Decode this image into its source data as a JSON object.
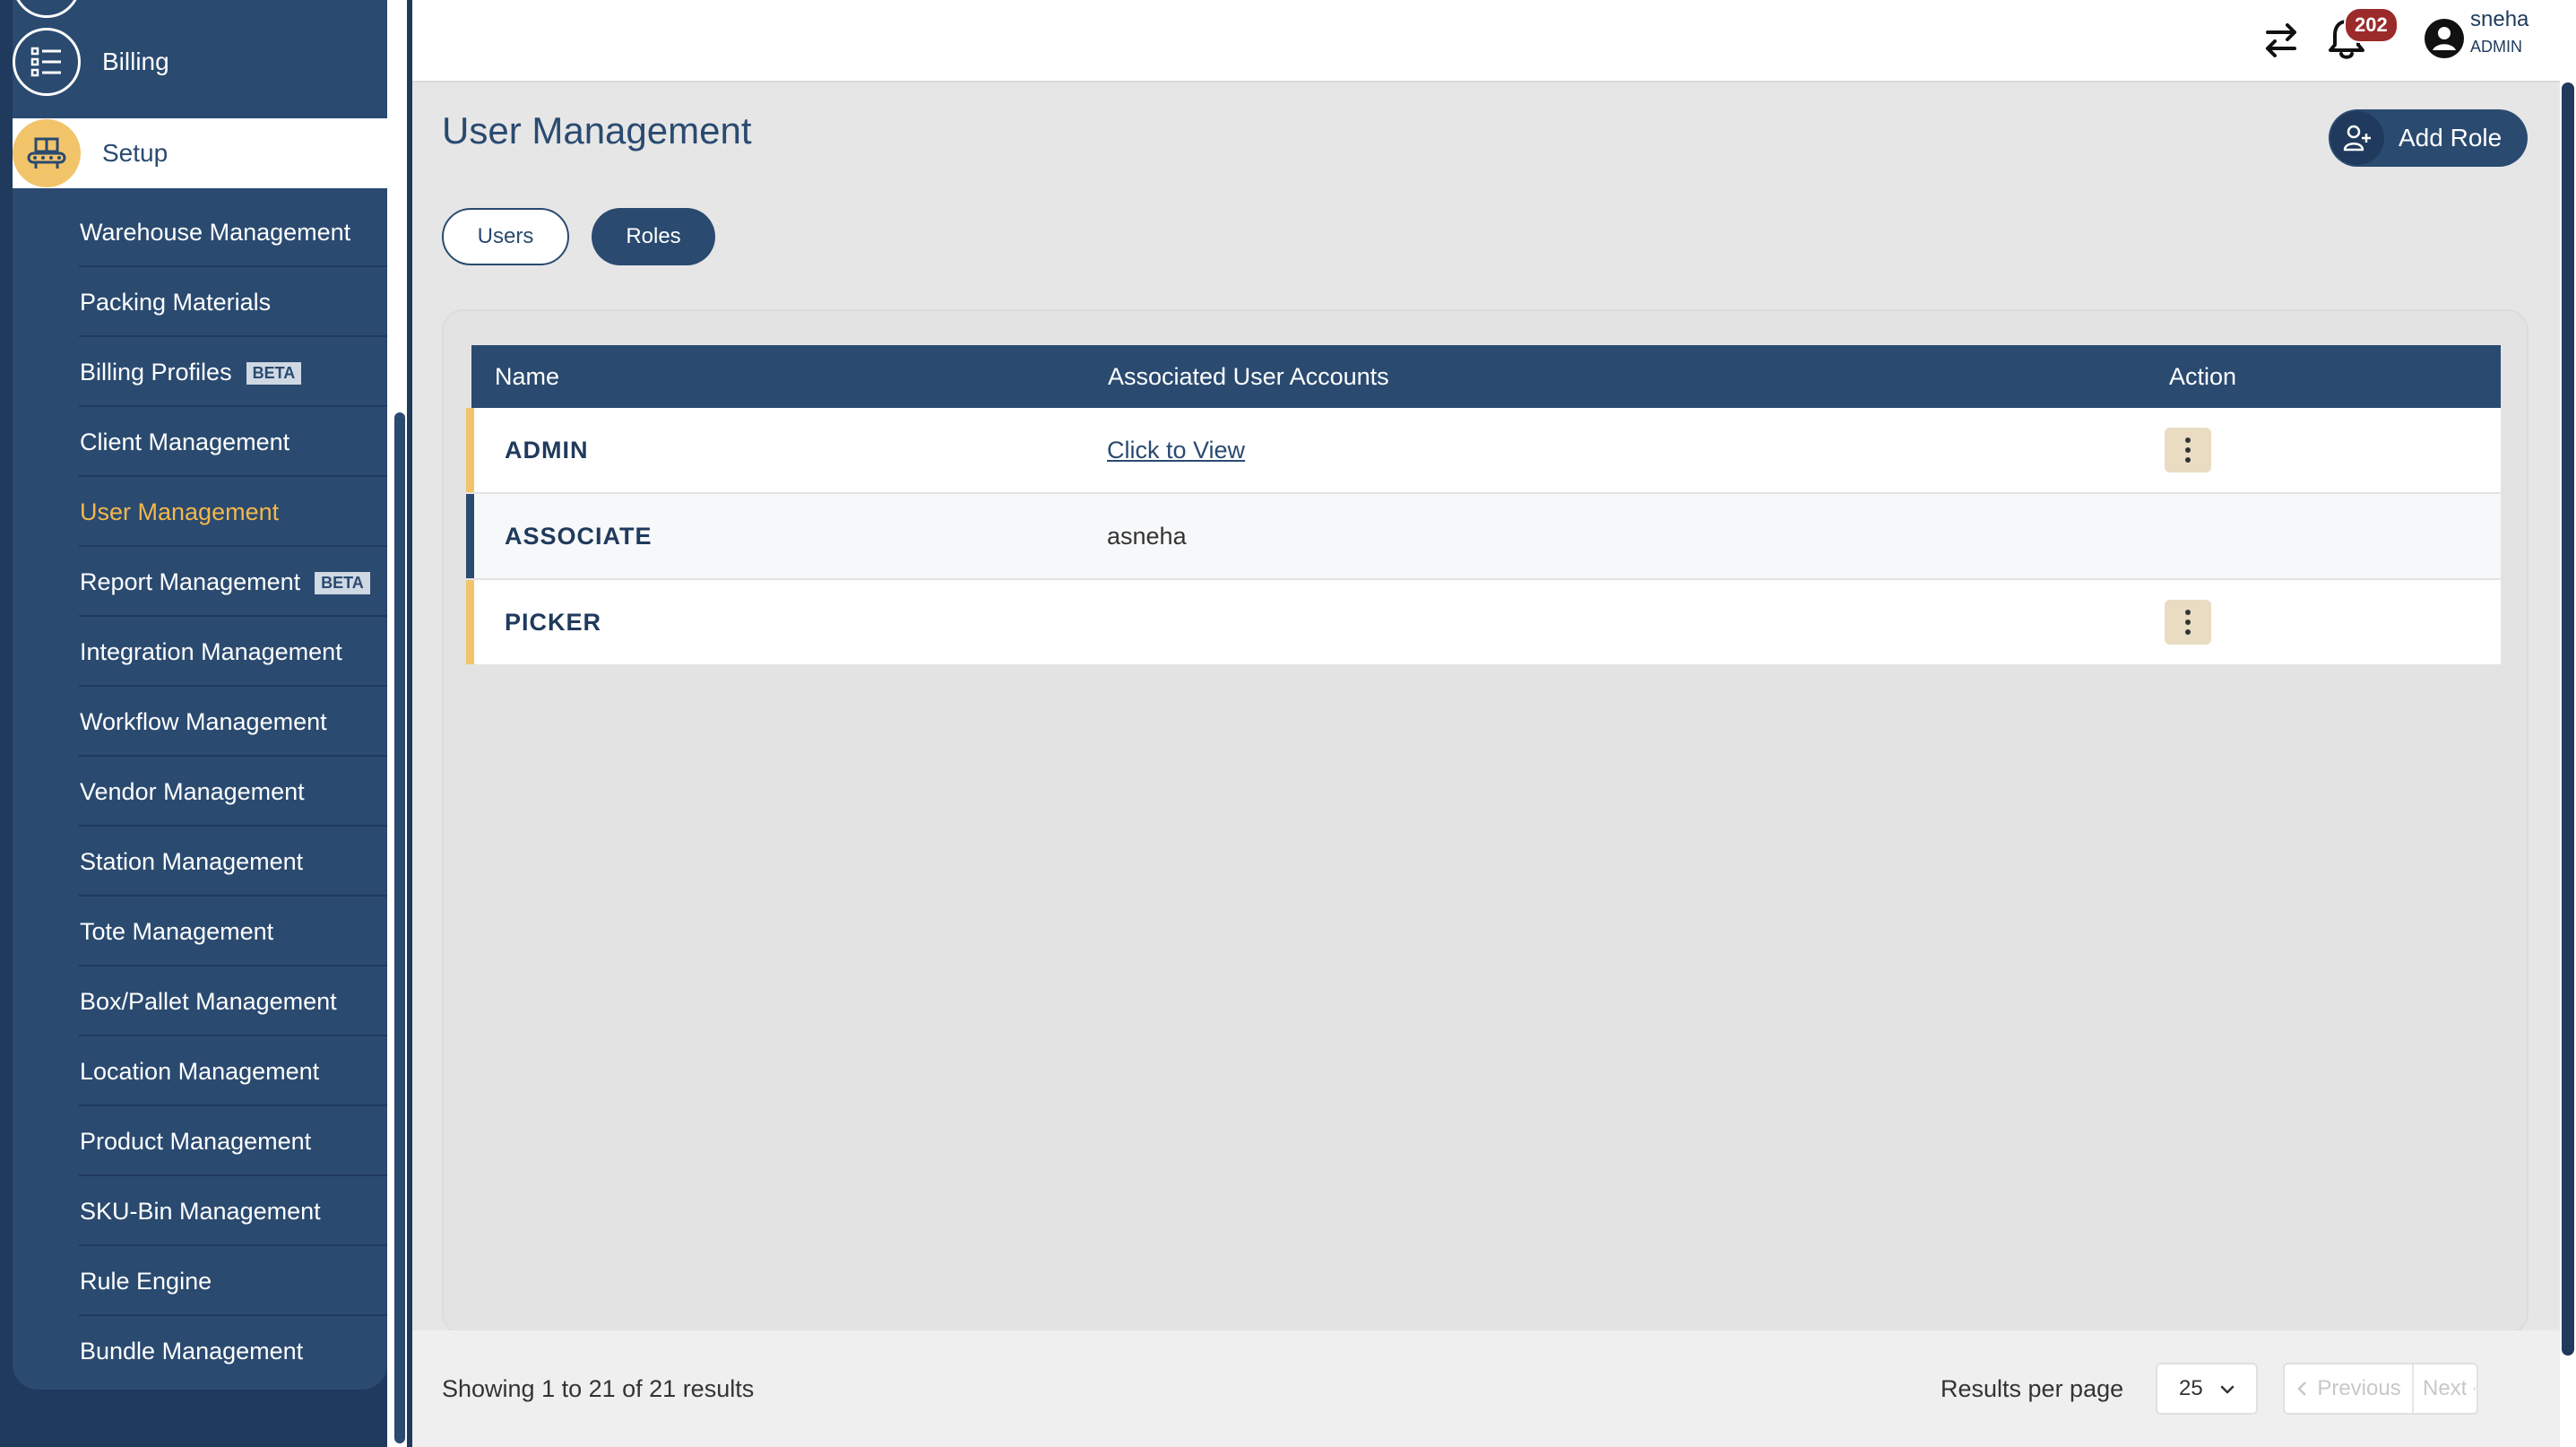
{
  "sidebar": {
    "billing_label": "Billing",
    "setup_label": "Setup",
    "items": [
      {
        "label": "Warehouse Management"
      },
      {
        "label": "Packing Materials"
      },
      {
        "label": "Billing Profiles",
        "badge": "BETA"
      },
      {
        "label": "Client Management"
      },
      {
        "label": "User Management",
        "active": true
      },
      {
        "label": "Report Management",
        "badge": "BETA"
      },
      {
        "label": "Integration Management"
      },
      {
        "label": "Workflow Management"
      },
      {
        "label": "Vendor Management"
      },
      {
        "label": "Station Management"
      },
      {
        "label": "Tote Management"
      },
      {
        "label": "Box/Pallet Management"
      },
      {
        "label": "Location Management"
      },
      {
        "label": "Product Management"
      },
      {
        "label": "SKU-Bin Management"
      },
      {
        "label": "Rule Engine"
      },
      {
        "label": "Bundle Management"
      }
    ]
  },
  "header": {
    "notification_count": "202",
    "user_name": "sneha",
    "user_role": "ADMIN"
  },
  "page": {
    "title": "User Management",
    "add_role_label": "Add Role",
    "tabs": [
      {
        "label": "Users",
        "active": false
      },
      {
        "label": "Roles",
        "active": true
      }
    ]
  },
  "table": {
    "columns": [
      "Name",
      "Associated User Accounts",
      "Action"
    ],
    "rows": [
      {
        "name": "ADMIN",
        "accounts": "Click to View",
        "has_action": true
      },
      {
        "name": "ASSOCIATE",
        "accounts": "asneha",
        "has_action": false
      },
      {
        "name": "PICKER",
        "accounts": "",
        "has_action": true
      }
    ]
  },
  "footer": {
    "showing": "Showing 1 to 21 of 21 results",
    "results_per_page_label": "Results per page",
    "results_per_page_value": "25",
    "previous_label": "Previous",
    "next_label": "Next"
  },
  "colors": {
    "primary": "#2a4a70",
    "accent": "#f2c46a",
    "badge": "#9b2b2b"
  }
}
